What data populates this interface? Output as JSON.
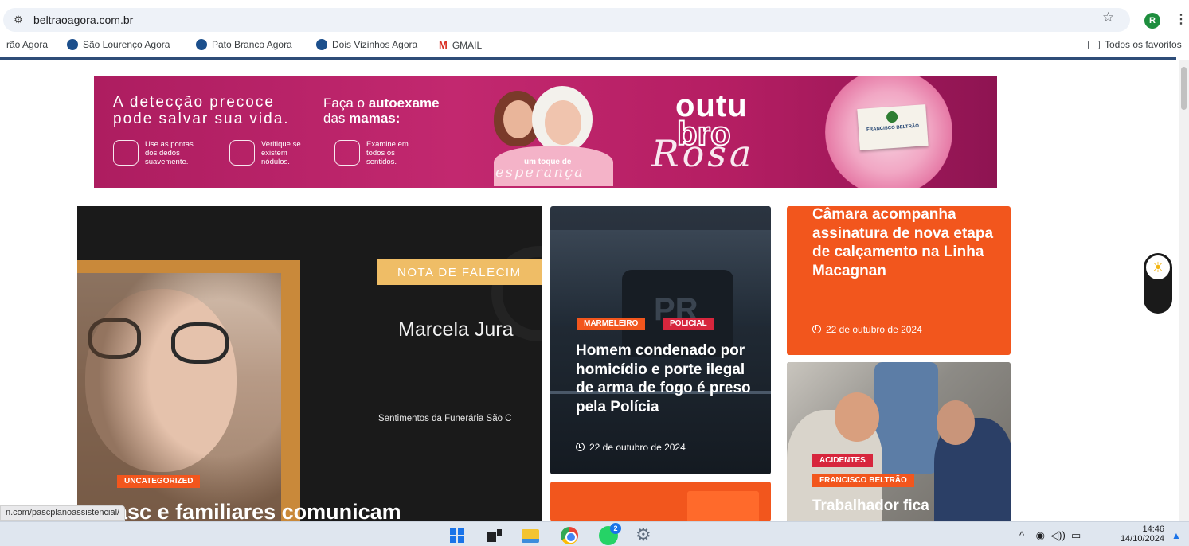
{
  "browser": {
    "url": "beltraoagora.com.br",
    "bookmarks": [
      {
        "label": "rão Agora"
      },
      {
        "label": "São Lourenço Agora"
      },
      {
        "label": "Pato Branco Agora"
      },
      {
        "label": "Dois Vizinhos Agora"
      },
      {
        "label": "GMAIL"
      }
    ],
    "all_bookmarks_label": "Todos os favoritos",
    "profile_initial": "R",
    "status_url": "n.com/pascplanoassistencial/"
  },
  "banner": {
    "line1": "A detecção precoce",
    "line2": "pode salvar sua vida.",
    "faca_prefix": "Faça o ",
    "faca_bold": "autoexame",
    "faca_line2_prefix": "das ",
    "faca_line2_bold": "mamas:",
    "steps": [
      {
        "text": "Use as pontas dos dedos suavemente."
      },
      {
        "text": "Verifique se existem nódulos."
      },
      {
        "text": "Examine em todos os sentidos."
      }
    ],
    "toque": "um toque de",
    "esperanca": "esperança",
    "outu": "outu",
    "bro": "bro",
    "rosa": "Rosa",
    "stamp_text": "FRANCISCO BELTRÃO"
  },
  "main_card": {
    "nota_label": "NOTA DE FALECIM",
    "person_name": "Marcela Jura",
    "sentiment": "Sentimentos da Funerária São C",
    "category": "UNCATEGORIZED",
    "headline": "asc e familiares comunicam"
  },
  "police_card": {
    "tags": [
      "MARMELEIRO",
      "POLICIAL"
    ],
    "title": "Homem condenado por homicídio e porte ilegal de arma de fogo é preso pela Polícia",
    "date": "22 de outubro de 2024",
    "plate_text": "PR"
  },
  "camara_card": {
    "title": "Câmara acompanha assinatura de nova etapa de calçamento na Linha Macagnan",
    "date": "22 de outubro de 2024"
  },
  "accident_card": {
    "tags": [
      "ACIDENTES",
      "FRANCISCO BELTRÃO"
    ],
    "title": "Trabalhador fica"
  },
  "taskbar": {
    "whatsapp_badge": "2",
    "time": "14:46",
    "date": "14/10/2024"
  },
  "colors": {
    "accent_orange": "#f2561d",
    "tag_red": "#d7263d",
    "banner_pink": "#c2286f",
    "nav_rule": "#2e4d78"
  }
}
